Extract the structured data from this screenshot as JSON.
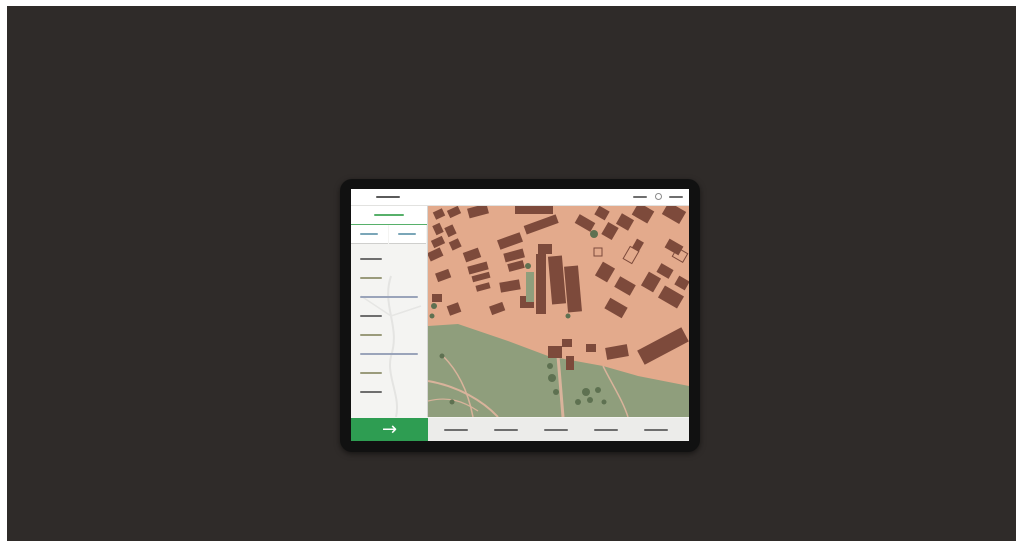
{
  "colors": {
    "backdrop": "#2f2b29",
    "tablet_bezel": "#111111",
    "map_land": "#e3aa8c",
    "map_buildings": "#7d4a3b",
    "map_green": "#8f9e7c",
    "map_trees": "#5e7151",
    "accent_green": "#2e9d52"
  },
  "app": {
    "top_bar": {
      "left_text": "",
      "right_icons": [
        "menu-line",
        "user-circle-icon",
        "menu-line"
      ]
    },
    "sidebar": {
      "main_tab": "",
      "sub_tabs": [
        "",
        ""
      ],
      "items": [
        "",
        "",
        "",
        "",
        "",
        "",
        "",
        ""
      ]
    },
    "map": {
      "type": "satellite-style city block map"
    },
    "bottom_bar": {
      "go_button_icon": "arrow-right-icon",
      "go_button_glyph": "→",
      "items": [
        "",
        "",
        "",
        "",
        ""
      ]
    }
  }
}
